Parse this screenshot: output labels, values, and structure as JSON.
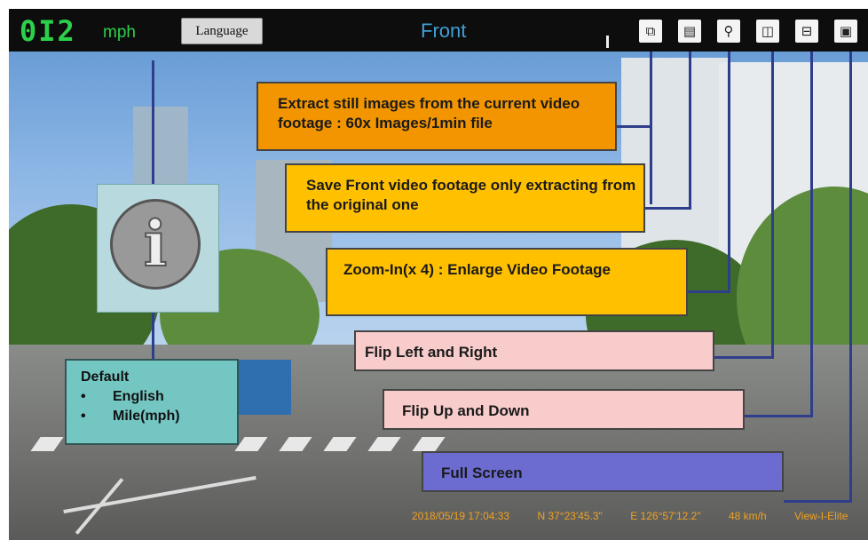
{
  "topbar": {
    "speed_value": "0I2",
    "speed_unit": "mph",
    "language_button": "Language",
    "view_title": "Front",
    "tools": [
      {
        "icon": "copy-icon",
        "glyph": "⧉"
      },
      {
        "icon": "save-icon",
        "glyph": "▤"
      },
      {
        "icon": "zoom-icon",
        "glyph": "⚲"
      },
      {
        "icon": "flip-horizontal-icon",
        "glyph": "◫"
      },
      {
        "icon": "flip-vertical-icon",
        "glyph": "⊟"
      },
      {
        "icon": "fullscreen-icon",
        "glyph": "▣"
      }
    ]
  },
  "info": {
    "glyph": "i",
    "default_title": "Default",
    "default_items": [
      "English",
      "Mile(mph)"
    ]
  },
  "callouts": {
    "extract": "Extract still images from the current video footage : 60x Images/1min file",
    "save_front": "Save Front video footage only extracting from the original one",
    "zoom": "Zoom-In(x 4) : Enlarge Video Footage",
    "flip_lr": "Flip Left and Right",
    "flip_ud": "Flip Up and Down",
    "full_screen": "Full Screen"
  },
  "status_bar": {
    "datetime": "2018/05/19 17:04:33",
    "latitude": "N 37°23'45.3\"",
    "longitude": "E 126°57'12.2\"",
    "speed": "48 km/h",
    "brand": "View-I-Elite"
  },
  "colors": {
    "speed_green": "#2bd14a",
    "title_blue": "#3fa0d6",
    "callout_orange": "#f29500",
    "callout_yellow": "#ffc000",
    "callout_pink": "#f9cccc",
    "callout_purple": "#6b6bd0",
    "leader_line": "#2f3e8c"
  }
}
